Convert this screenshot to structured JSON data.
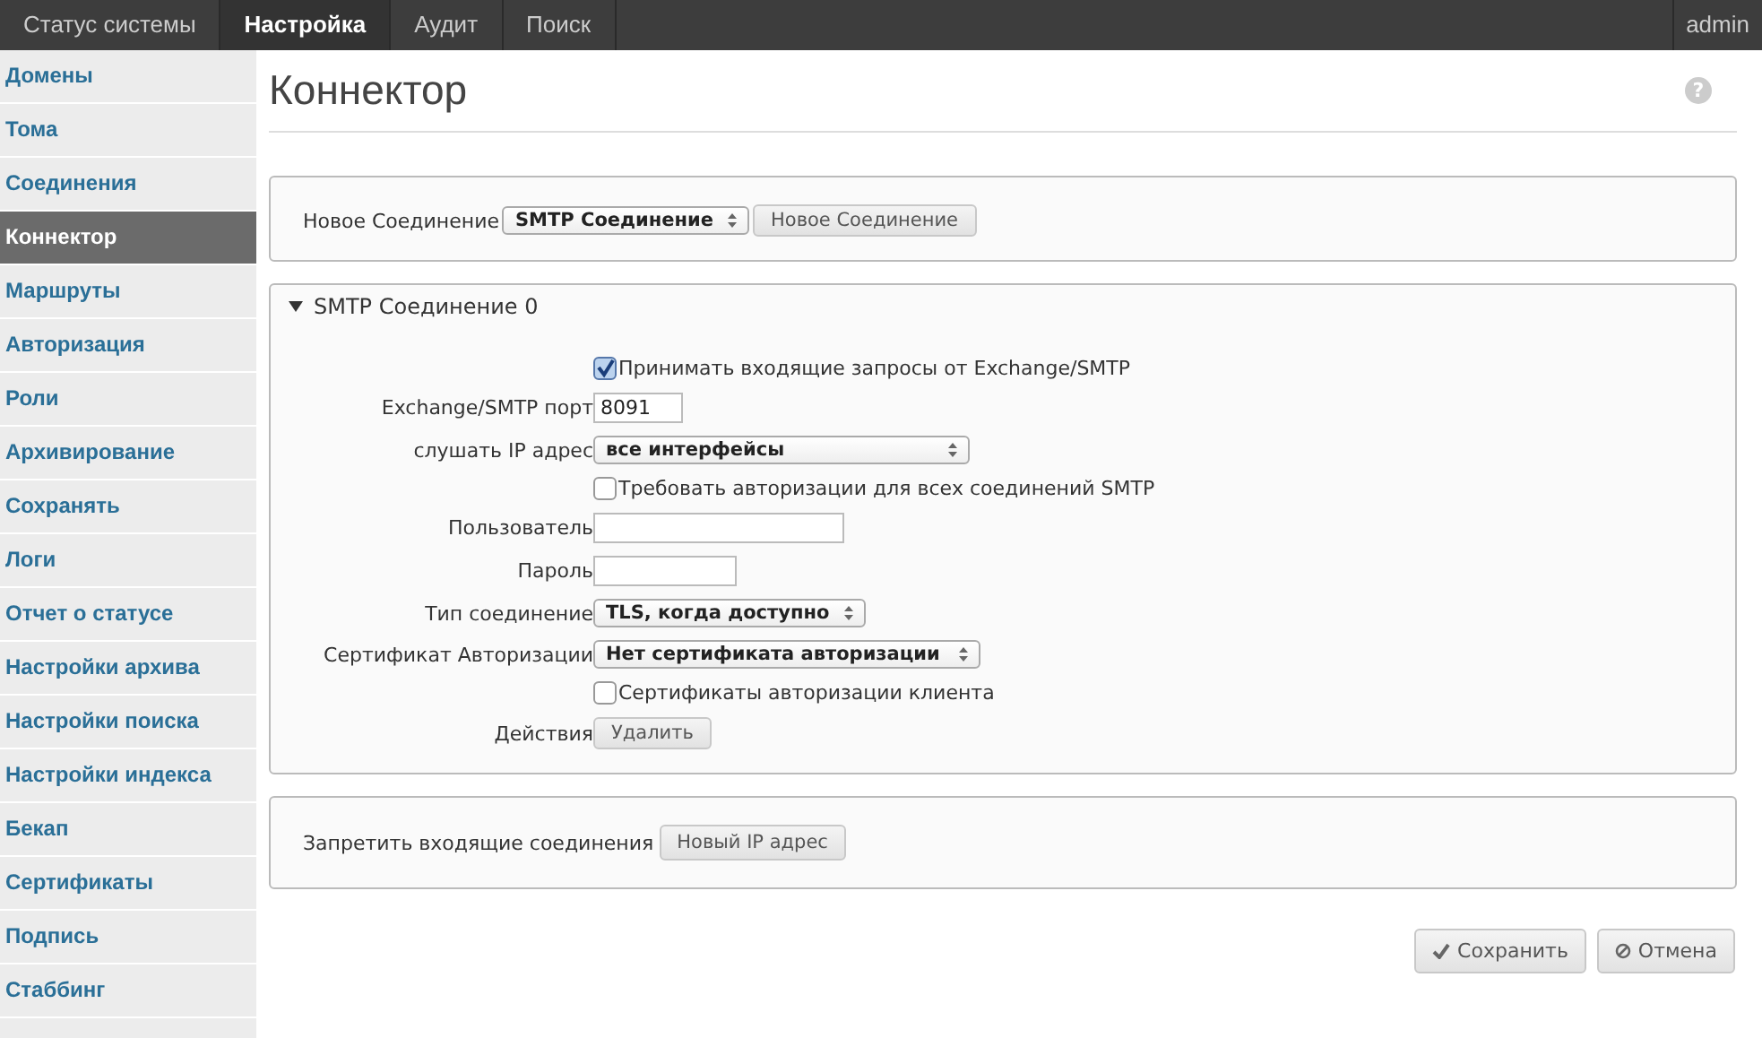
{
  "top_nav": {
    "tabs": [
      {
        "label": "Статус системы",
        "selected": false
      },
      {
        "label": "Настройка",
        "selected": true
      },
      {
        "label": "Аудит",
        "selected": false
      },
      {
        "label": "Поиск",
        "selected": false
      }
    ],
    "user": "admin"
  },
  "sidebar": {
    "items": [
      {
        "label": "Домены",
        "selected": false
      },
      {
        "label": "Тома",
        "selected": false
      },
      {
        "label": "Соединения",
        "selected": false
      },
      {
        "label": "Коннектор",
        "selected": true
      },
      {
        "label": "Маршруты",
        "selected": false
      },
      {
        "label": "Авторизация",
        "selected": false
      },
      {
        "label": "Роли",
        "selected": false
      },
      {
        "label": "Архивирование",
        "selected": false
      },
      {
        "label": "Сохранять",
        "selected": false
      },
      {
        "label": "Логи",
        "selected": false
      },
      {
        "label": "Отчет о статусе",
        "selected": false
      },
      {
        "label": "Настройки архива",
        "selected": false
      },
      {
        "label": "Настройки поиска",
        "selected": false
      },
      {
        "label": "Настройки индекса",
        "selected": false
      },
      {
        "label": "Бекап",
        "selected": false
      },
      {
        "label": "Сертификаты",
        "selected": false
      },
      {
        "label": "Подпись",
        "selected": false
      },
      {
        "label": "Стаббинг",
        "selected": false
      }
    ]
  },
  "page": {
    "title": "Коннектор",
    "help": "?"
  },
  "new_connection": {
    "label": "Новое Соединение",
    "select": "SMTP Соединение",
    "button": "Новое Соединение"
  },
  "connection": {
    "title": "SMTP Соединение 0",
    "expanded": true,
    "rows": [
      {
        "kind": "checkbox",
        "text": "Принимать входящие запросы от Exchange/SMTP",
        "checked": true
      },
      {
        "kind": "input",
        "label": "Exchange/SMTP порт",
        "value": "8091"
      },
      {
        "kind": "select",
        "label": "слушать IP адрес",
        "value": "все интерфейсы"
      },
      {
        "kind": "checkbox",
        "text": "Требовать авторизации для всех соединений SMTP",
        "checked": false
      },
      {
        "kind": "input",
        "label": "Пользователь"
      },
      {
        "kind": "input",
        "label": "Пароль"
      },
      {
        "kind": "select",
        "label": "Тип соединение",
        "value": "TLS, когда доступно"
      },
      {
        "kind": "select",
        "label": "Сертификат Авторизации",
        "value": "Нет сертификата авторизации"
      },
      {
        "kind": "checkbox",
        "text": "Сертификаты авторизации клиента",
        "checked": false
      },
      {
        "kind": "button",
        "label": "Действия",
        "button": "Удалить"
      }
    ]
  },
  "deny": {
    "label": "Запретить входящие соединения",
    "button": "Новый IP адрес"
  },
  "actions": [
    {
      "kind": "save",
      "label": "Сохранить"
    },
    {
      "kind": "cancel",
      "label": "Отмена"
    }
  ]
}
